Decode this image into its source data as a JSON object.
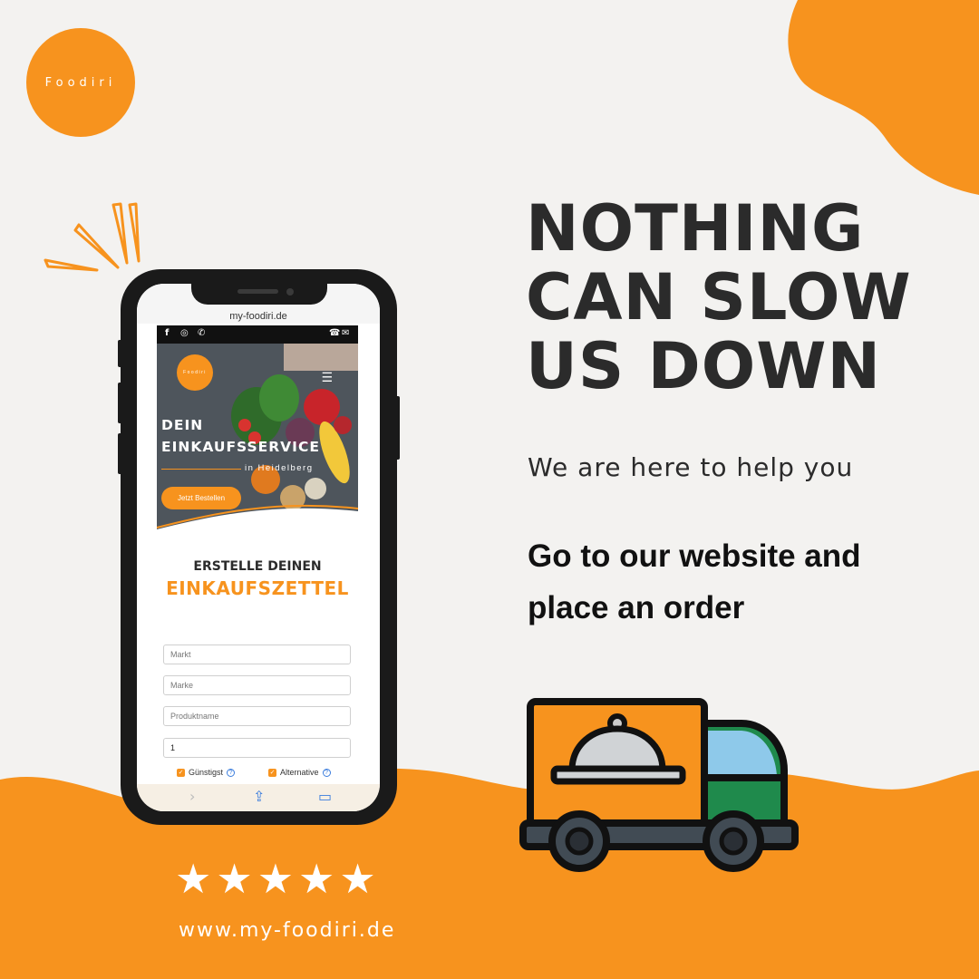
{
  "logo": {
    "text": "Foodiri"
  },
  "headline": {
    "line1": "NOTHING",
    "line2": "CAN SLOW",
    "line3": "US DOWN"
  },
  "subline": "We are here to help you",
  "cta": {
    "line1": "Go to our website and",
    "line2": "place an order"
  },
  "rating": {
    "stars": 5,
    "star_glyph": "★"
  },
  "website": "www.my-foodiri.de",
  "colors": {
    "accent": "#f7931e",
    "background": "#f3f2f0",
    "text": "#2b2b2b"
  },
  "phone": {
    "address_bar": "my-foodiri.de",
    "topbar_icons": [
      "facebook-icon",
      "instagram-icon",
      "whatsapp-icon",
      "phone-icon",
      "mail-icon"
    ],
    "hero": {
      "logo_text": "Foodiri",
      "title_line1": "DEIN",
      "title_line2": "EINKAUFSSERVICE",
      "subtitle": "in Heidelberg",
      "button": "Jetzt Bestellen"
    },
    "list": {
      "heading1": "ERSTELLE DEINEN",
      "heading2": "EINKAUFSZETTEL",
      "fields": [
        {
          "placeholder": "Markt"
        },
        {
          "placeholder": "Marke"
        },
        {
          "placeholder": "Produktname"
        },
        {
          "value": "1"
        }
      ],
      "checkboxes": [
        {
          "label": "Günstigst",
          "checked": true
        },
        {
          "label": "Alternative",
          "checked": true
        }
      ]
    }
  }
}
